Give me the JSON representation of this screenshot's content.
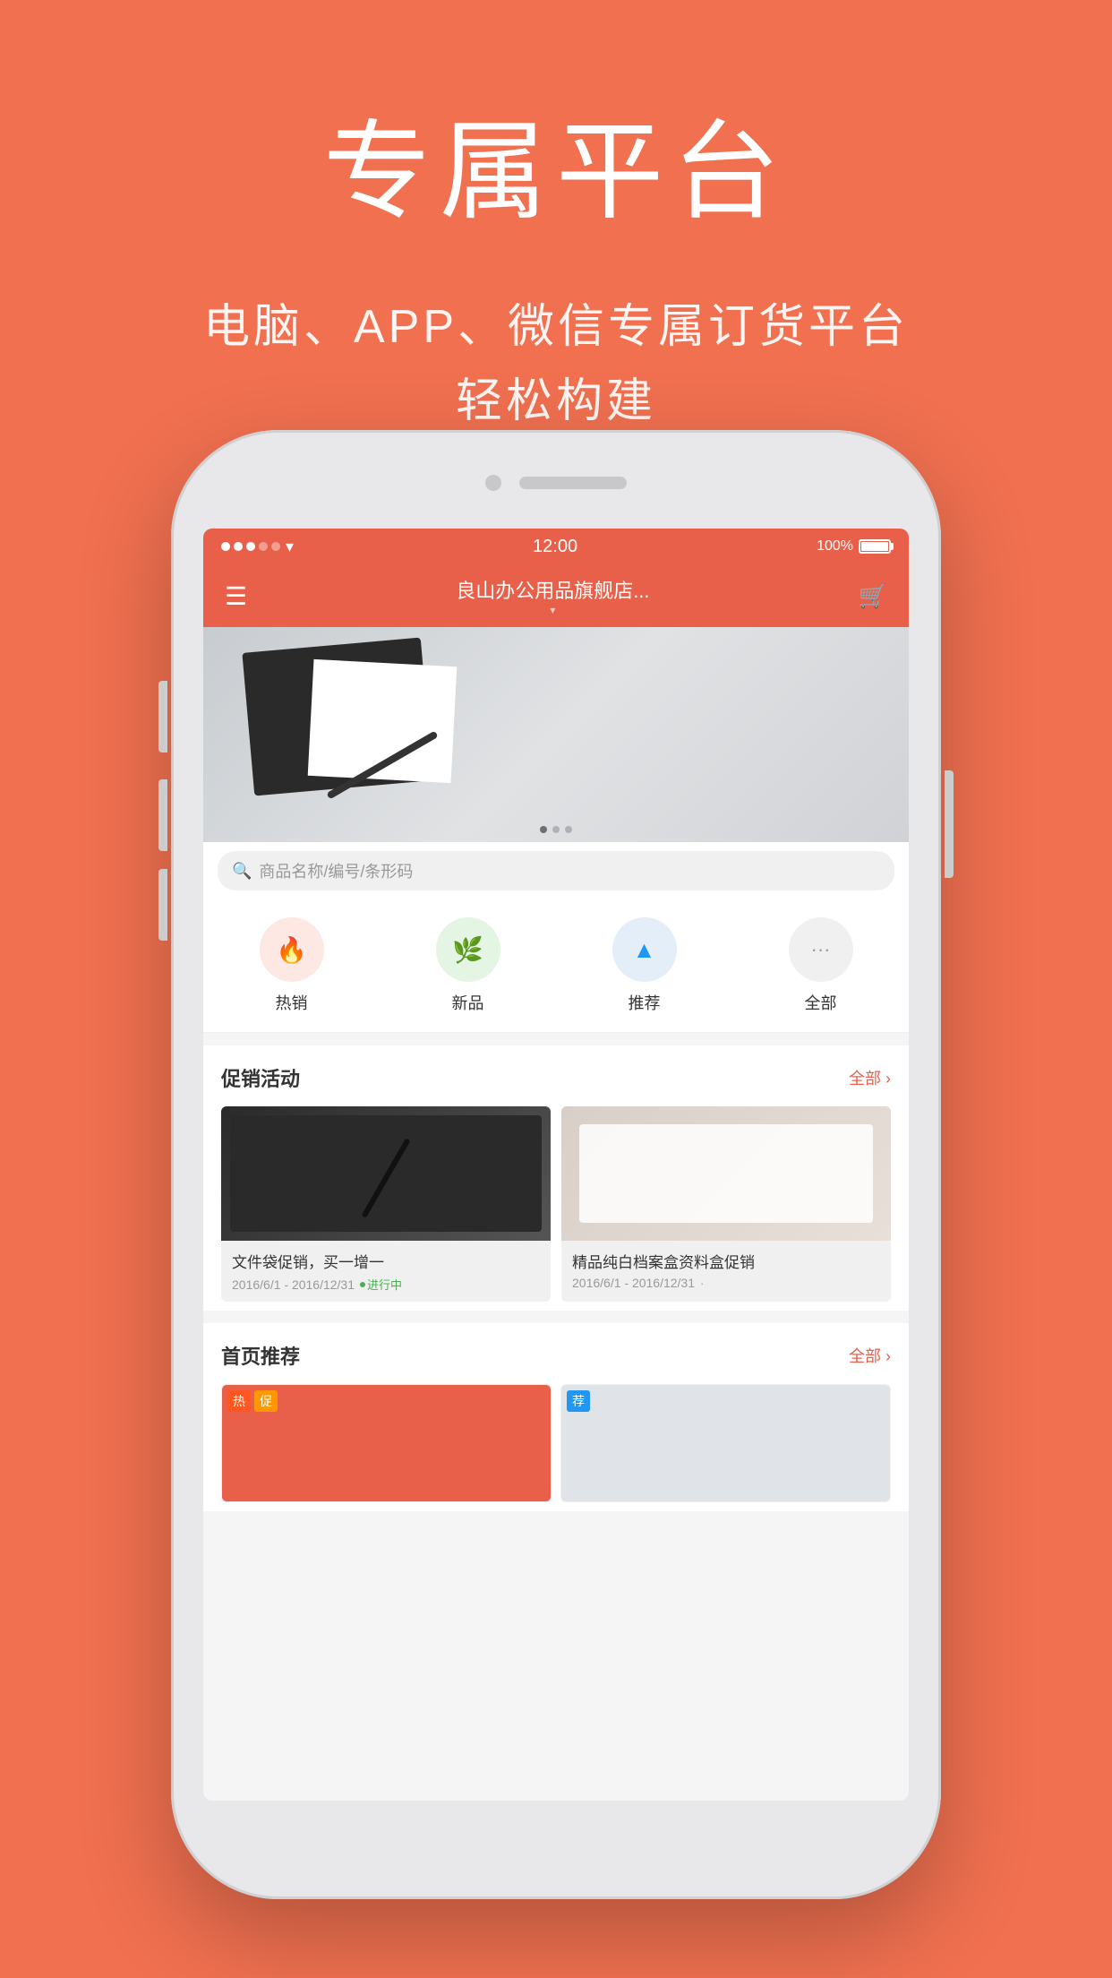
{
  "page": {
    "background_color": "#F07050"
  },
  "header": {
    "main_title": "专属平台",
    "subtitle_line1": "电脑、APP、微信专属订货平台",
    "subtitle_line2": "轻松构建"
  },
  "phone": {
    "status_bar": {
      "time": "12:00",
      "battery": "100%",
      "signal": "●●●○○"
    },
    "nav": {
      "title": "良山办公用品旗舰店...",
      "subtitle": "▼",
      "left_icon": "menu",
      "right_icon": "cart"
    },
    "search": {
      "placeholder": "商品名称/编号/条形码"
    },
    "categories": [
      {
        "id": "hot",
        "label": "热销",
        "icon": "🔥",
        "circle_class": "circle-hot"
      },
      {
        "id": "new",
        "label": "新品",
        "icon": "🌿",
        "circle_class": "circle-new"
      },
      {
        "id": "rec",
        "label": "推荐",
        "icon": "▲",
        "circle_class": "circle-rec"
      },
      {
        "id": "all",
        "label": "全部",
        "icon": "···",
        "circle_class": "circle-all"
      }
    ],
    "promo_section": {
      "title": "促销活动",
      "more_label": "全部 ›",
      "items": [
        {
          "name": "文件袋促销，买一增一",
          "date": "2016/6/1 - 2016/12/31",
          "status": "进行中",
          "status_color": "#4CAF50"
        },
        {
          "name": "精品纯白档案盒资料盒促销",
          "date": "2016/6/1 - 2016/12/31",
          "status": "·",
          "status_color": "#999"
        }
      ]
    },
    "recommend_section": {
      "title": "首页推荐",
      "more_label": "全部 ›"
    }
  }
}
